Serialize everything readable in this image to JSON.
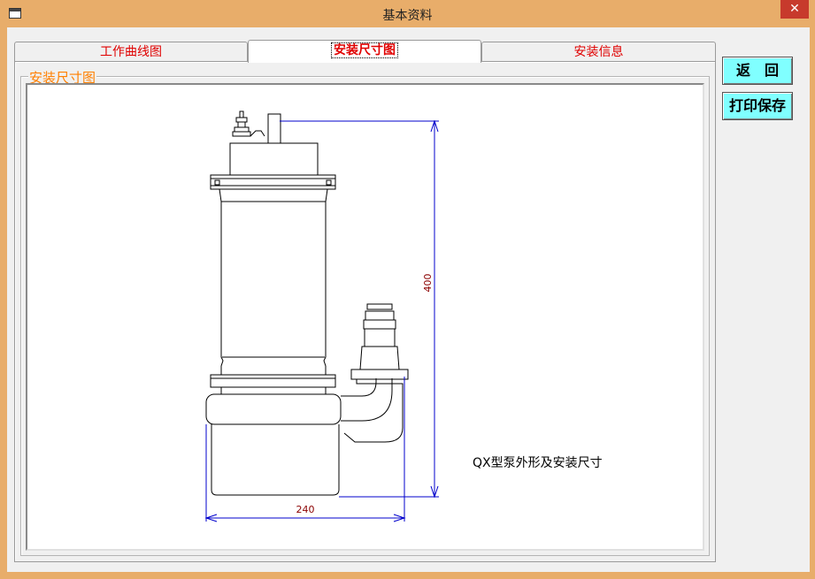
{
  "window": {
    "title": "基本资料",
    "close_label": "✕"
  },
  "tabs": [
    {
      "label": "工作曲线图",
      "active": false
    },
    {
      "label": "安装尺寸图",
      "active": true
    },
    {
      "label": "安装信息",
      "active": false
    }
  ],
  "group": {
    "title": "安装尺寸图"
  },
  "drawing": {
    "height_dim": "400",
    "width_dim": "240",
    "caption": "QX型泵外形及安装尺寸"
  },
  "buttons": {
    "back": "返　回",
    "print_save": "打印保存"
  },
  "colors": {
    "tab_text": "#e00000",
    "group_title": "#ff8000",
    "dim_line": "#0000cc",
    "dim_text": "#8b0000",
    "button_bg": "#80ffff",
    "window_frame": "#e8ad6a"
  }
}
